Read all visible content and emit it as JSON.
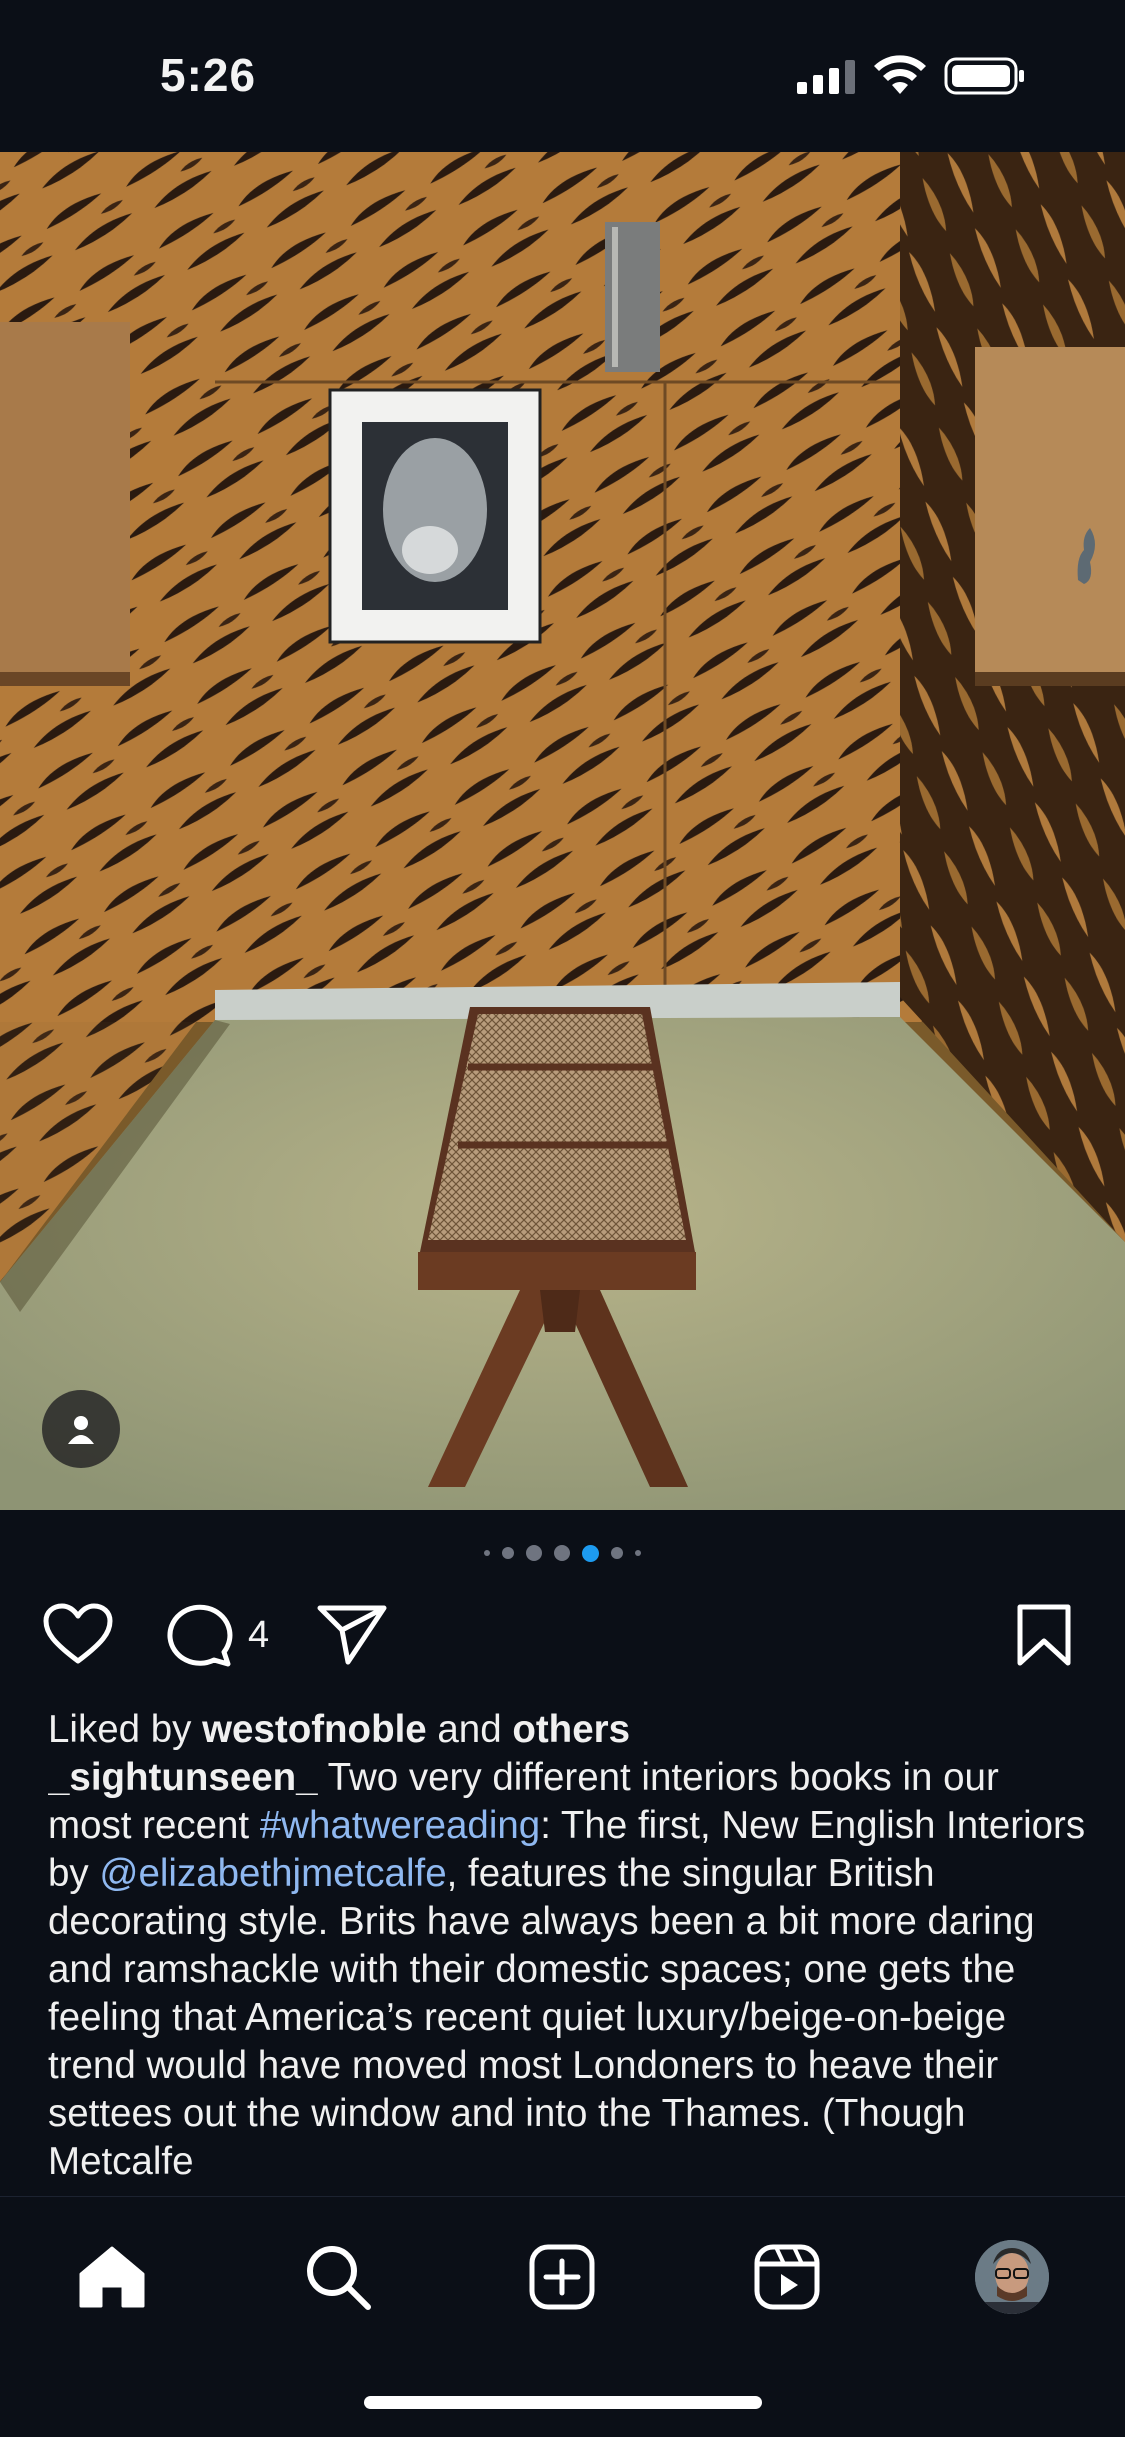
{
  "status_bar": {
    "time": "5:26"
  },
  "post": {
    "image_count": 7,
    "active_image_index": 4,
    "comment_count": "4"
  },
  "caption": {
    "liked_prefix": "Liked by ",
    "liked_user": "westofnoble",
    "liked_and": " and ",
    "liked_others": "others",
    "username": "_sightunseen_",
    "text_1": " Two very different interiors books in our most recent ",
    "hashtag": "#whatwereading",
    "text_2": ": The first, New English Interiors by ",
    "mention": "@elizabethjmetcalfe",
    "text_3": ", features the singular British decorating style. Brits have always been a bit more daring and ramshackle with their domestic spaces; one gets the feeling that America’s recent quiet luxury/beige-on-beige trend would have moved most Londoners to heave their settees out the window and into the Thames. (Though Metcalfe"
  },
  "icons": {
    "person_tag": "person-icon",
    "like": "heart-icon",
    "comment": "comment-icon",
    "share": "paper-plane-icon",
    "save": "bookmark-icon",
    "home": "home-icon",
    "search": "search-icon",
    "create": "plus-square-icon",
    "reels": "reels-icon",
    "profile": "avatar"
  },
  "colors": {
    "background": "#0b0f17",
    "link": "#8fb8f0",
    "active_dot": "#1d9bf0"
  }
}
